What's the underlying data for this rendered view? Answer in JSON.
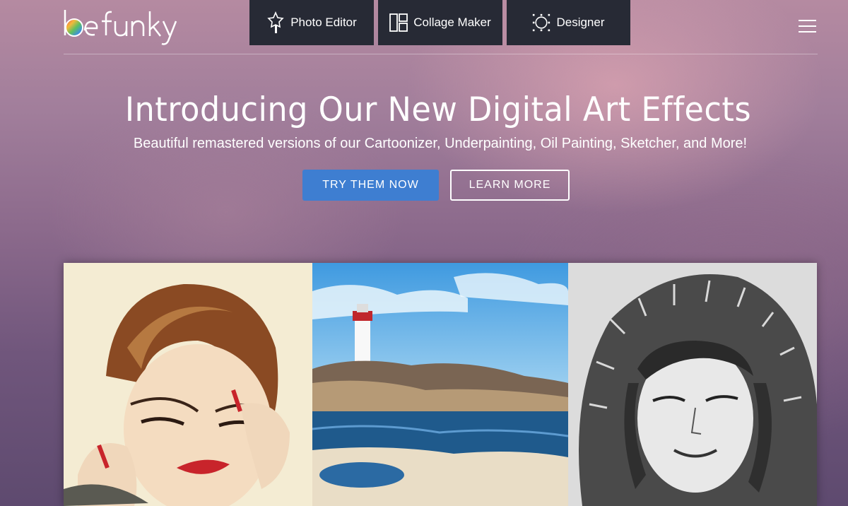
{
  "header": {
    "logo_text": "befunky",
    "nav": [
      {
        "label": "Photo Editor",
        "icon": "magic-wand-icon"
      },
      {
        "label": "Collage Maker",
        "icon": "collage-grid-icon"
      },
      {
        "label": "Designer",
        "icon": "designer-frame-icon"
      }
    ],
    "menu_icon": "hamburger-icon"
  },
  "hero": {
    "title": "Introducing Our New Digital Art Effects",
    "subtitle": "Beautiful remastered versions of our Cartoonizer, Underpainting, Oil Painting, Sketcher, and More!",
    "primary_button": "TRY THEM NOW",
    "secondary_button": "LEARN MORE"
  },
  "showcase": {
    "panels": [
      {
        "subject": "cartoonized portrait"
      },
      {
        "subject": "painted lighthouse landscape"
      },
      {
        "subject": "pencil sketch portrait"
      }
    ]
  },
  "colors": {
    "nav_bg": "#272a35",
    "primary_button": "#3e7ed1",
    "text": "#ffffff"
  }
}
